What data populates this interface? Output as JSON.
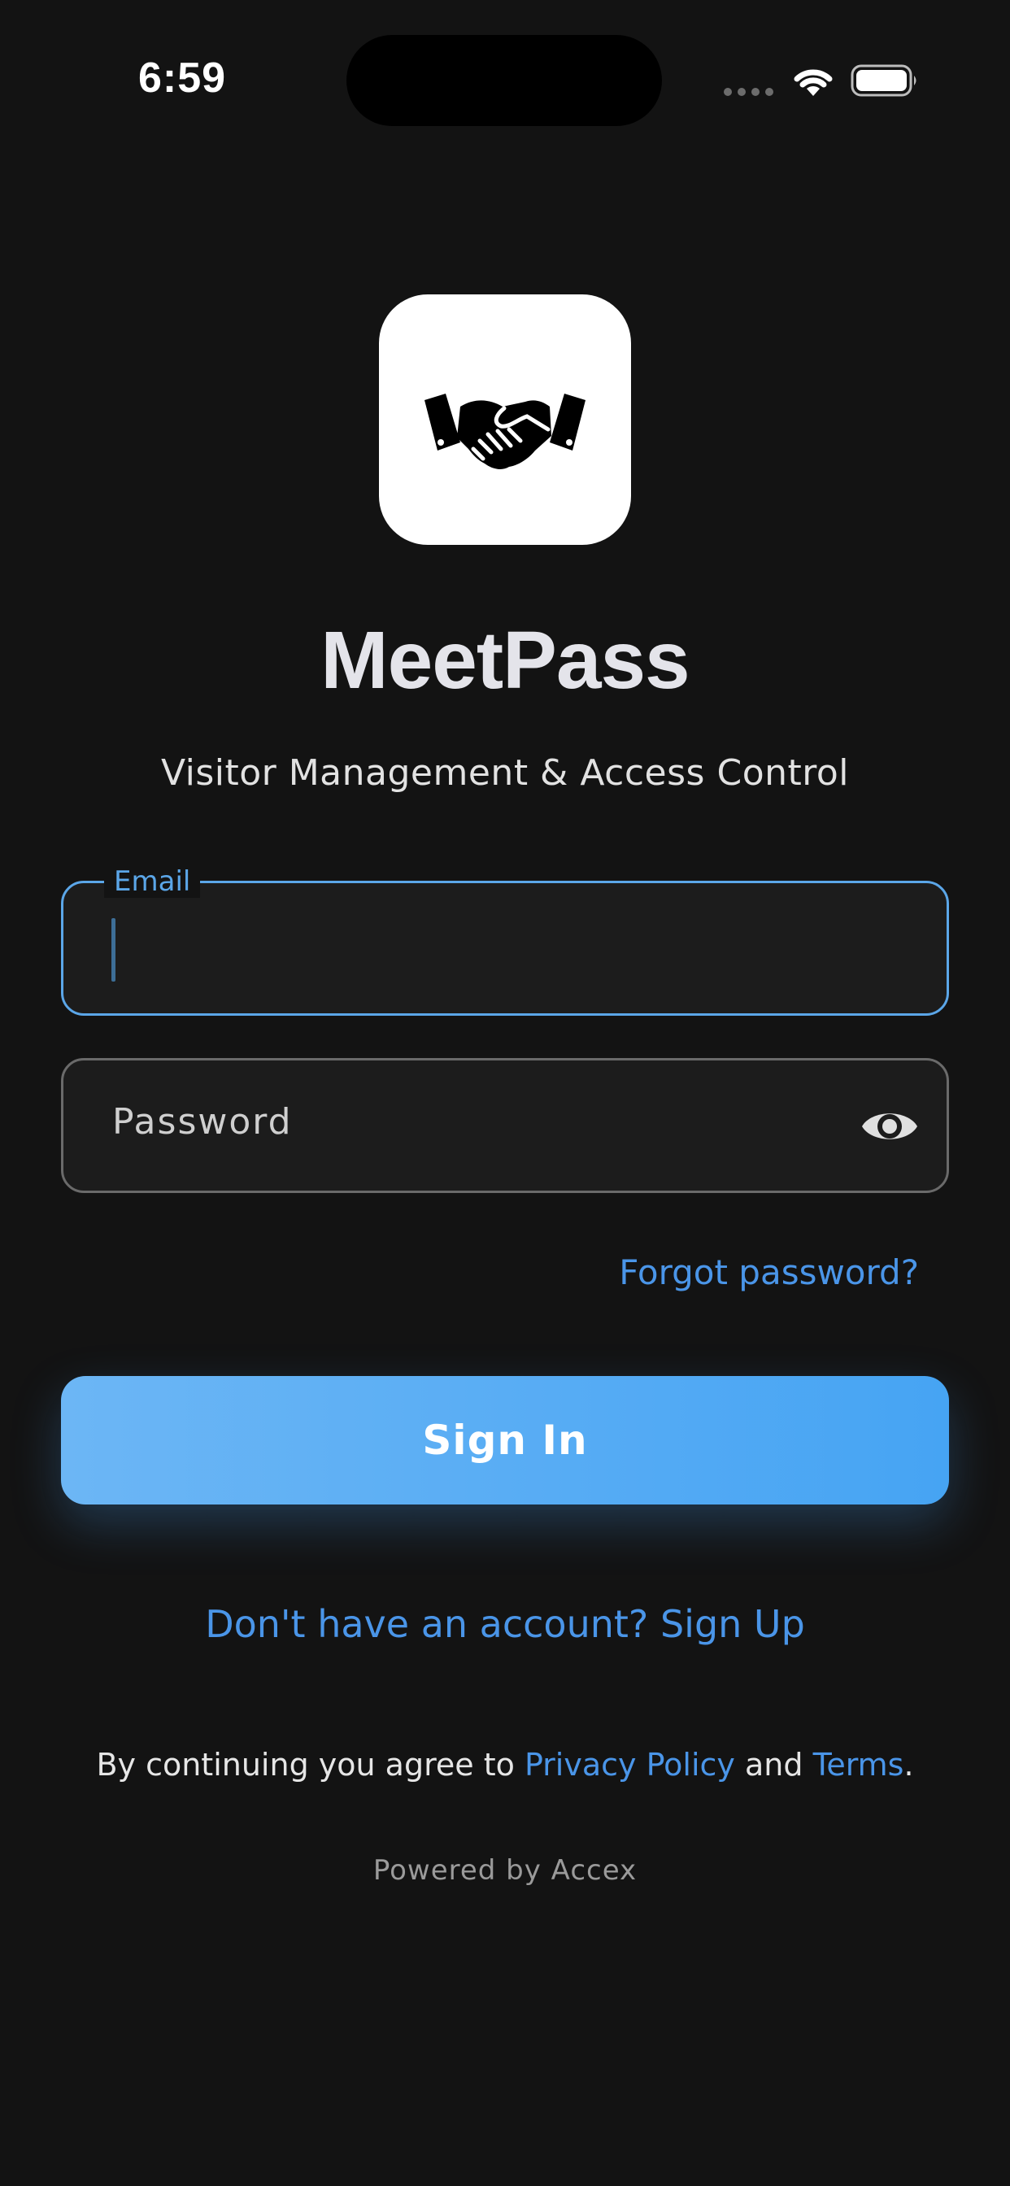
{
  "status_bar": {
    "time": "6:59",
    "icons": [
      "cellular-signal-icon",
      "wifi-icon",
      "battery-icon"
    ]
  },
  "app": {
    "logo_icon": "handshake-icon",
    "title": "MeetPass",
    "subtitle": "Visitor Management & Access Control"
  },
  "form": {
    "email": {
      "label": "Email",
      "value": ""
    },
    "password": {
      "placeholder": "Password",
      "toggle_icon": "eye-icon"
    },
    "forgot_password": "Forgot password?",
    "sign_in": "Sign In",
    "sign_up": "Don't have an account? Sign Up"
  },
  "legal": {
    "prefix": "By continuing you agree to ",
    "privacy": "Privacy Policy",
    "and": " and ",
    "terms": "Terms",
    "suffix": "."
  },
  "footer": {
    "powered_by": "Powered by Accex"
  },
  "colors": {
    "background": "#131313",
    "accent": "#4a95e8",
    "focus_border": "#5ba6e8",
    "button_gradient_start": "#6cb6f5",
    "button_gradient_end": "#46a4f3"
  }
}
